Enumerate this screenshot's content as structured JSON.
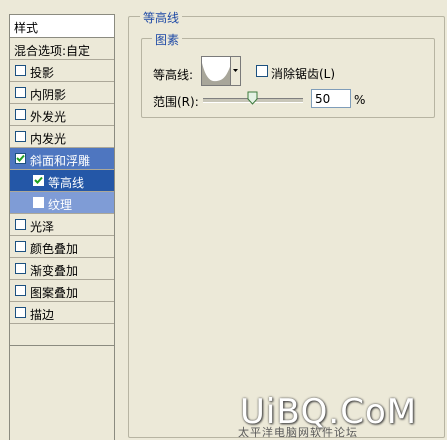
{
  "sidebar": {
    "header": "样式",
    "blend": "混合选项:自定",
    "items": [
      {
        "label": "投影",
        "checked": false
      },
      {
        "label": "内阴影",
        "checked": false
      },
      {
        "label": "外发光",
        "checked": false
      },
      {
        "label": "内发光",
        "checked": false
      },
      {
        "label": "斜面和浮雕",
        "checked": true
      },
      {
        "label": "等高线",
        "checked": true
      },
      {
        "label": "纹理",
        "checked": false
      },
      {
        "label": "光泽",
        "checked": false
      },
      {
        "label": "颜色叠加",
        "checked": false
      },
      {
        "label": "渐变叠加",
        "checked": false
      },
      {
        "label": "图案叠加",
        "checked": false
      },
      {
        "label": "描边",
        "checked": false
      }
    ]
  },
  "panel": {
    "title": "等高线",
    "group_title": "图素",
    "contour_label": "等高线:",
    "antialias_label": "消除锯齿(L)",
    "antialias_checked": false,
    "range_label": "范围(R):",
    "range_value": "50",
    "range_unit": "%",
    "range_fraction": 0.5
  },
  "watermark": {
    "main": "UiBQ.CoM",
    "sub": "太平洋电脑网软件论坛"
  }
}
